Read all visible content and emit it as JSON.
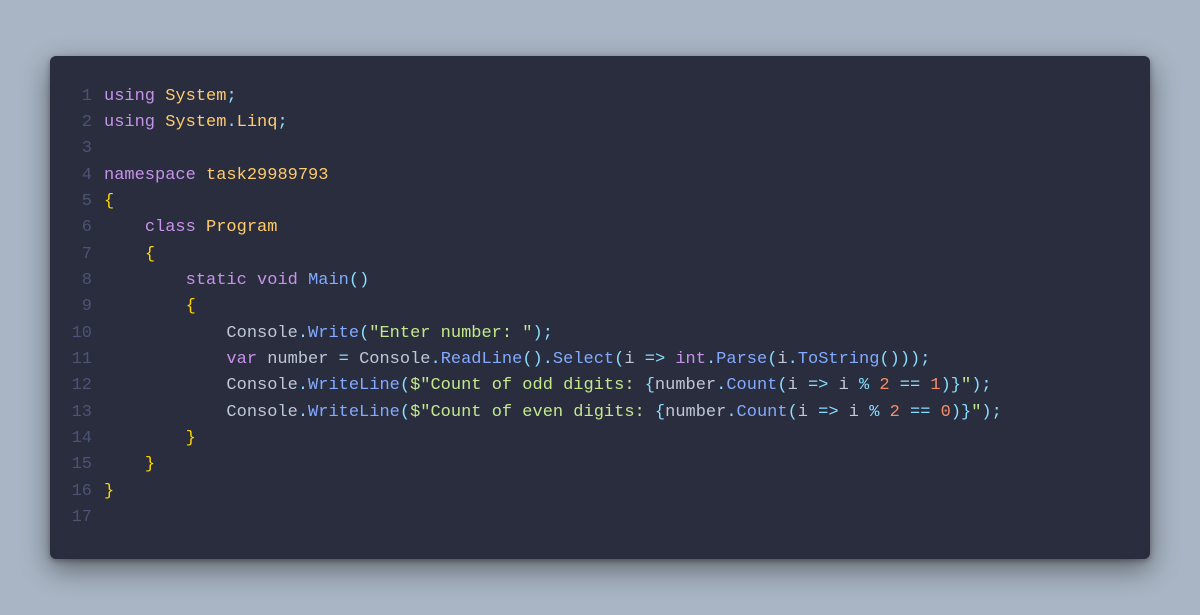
{
  "code": {
    "lines": [
      {
        "n": "1",
        "tokens": [
          {
            "c": "kw",
            "t": "using"
          },
          {
            "c": "",
            "t": " "
          },
          {
            "c": "ns",
            "t": "System"
          },
          {
            "c": "op",
            "t": ";"
          }
        ]
      },
      {
        "n": "2",
        "tokens": [
          {
            "c": "kw",
            "t": "using"
          },
          {
            "c": "",
            "t": " "
          },
          {
            "c": "ns",
            "t": "System"
          },
          {
            "c": "op",
            "t": "."
          },
          {
            "c": "ns",
            "t": "Linq"
          },
          {
            "c": "op",
            "t": ";"
          }
        ]
      },
      {
        "n": "3",
        "tokens": [
          {
            "c": "",
            "t": ""
          }
        ]
      },
      {
        "n": "4",
        "tokens": [
          {
            "c": "kw",
            "t": "namespace"
          },
          {
            "c": "",
            "t": " "
          },
          {
            "c": "ns",
            "t": "task29989793"
          }
        ]
      },
      {
        "n": "5",
        "tokens": [
          {
            "c": "brace",
            "t": "{"
          }
        ]
      },
      {
        "n": "6",
        "tokens": [
          {
            "c": "",
            "t": "    "
          },
          {
            "c": "kw",
            "t": "class"
          },
          {
            "c": "",
            "t": " "
          },
          {
            "c": "ns",
            "t": "Program"
          }
        ]
      },
      {
        "n": "7",
        "tokens": [
          {
            "c": "",
            "t": "    "
          },
          {
            "c": "brace",
            "t": "{"
          }
        ]
      },
      {
        "n": "8",
        "tokens": [
          {
            "c": "",
            "t": "        "
          },
          {
            "c": "kw",
            "t": "static"
          },
          {
            "c": "",
            "t": " "
          },
          {
            "c": "kw",
            "t": "void"
          },
          {
            "c": "",
            "t": " "
          },
          {
            "c": "fn",
            "t": "Main"
          },
          {
            "c": "op",
            "t": "()"
          }
        ]
      },
      {
        "n": "9",
        "tokens": [
          {
            "c": "",
            "t": "        "
          },
          {
            "c": "brace",
            "t": "{"
          }
        ]
      },
      {
        "n": "10",
        "tokens": [
          {
            "c": "",
            "t": "            "
          },
          {
            "c": "id",
            "t": "Console"
          },
          {
            "c": "op",
            "t": "."
          },
          {
            "c": "fn",
            "t": "Write"
          },
          {
            "c": "op",
            "t": "("
          },
          {
            "c": "str",
            "t": "\"Enter number: \""
          },
          {
            "c": "op",
            "t": ")"
          },
          {
            "c": "op",
            "t": ";"
          }
        ]
      },
      {
        "n": "11",
        "tokens": [
          {
            "c": "",
            "t": "            "
          },
          {
            "c": "kw",
            "t": "var"
          },
          {
            "c": "",
            "t": " "
          },
          {
            "c": "id",
            "t": "number"
          },
          {
            "c": "",
            "t": " "
          },
          {
            "c": "op",
            "t": "="
          },
          {
            "c": "",
            "t": " "
          },
          {
            "c": "id",
            "t": "Console"
          },
          {
            "c": "op",
            "t": "."
          },
          {
            "c": "fn",
            "t": "ReadLine"
          },
          {
            "c": "op",
            "t": "()."
          },
          {
            "c": "fn",
            "t": "Select"
          },
          {
            "c": "op",
            "t": "("
          },
          {
            "c": "id",
            "t": "i"
          },
          {
            "c": "",
            "t": " "
          },
          {
            "c": "op",
            "t": "=>"
          },
          {
            "c": "",
            "t": " "
          },
          {
            "c": "kw",
            "t": "int"
          },
          {
            "c": "op",
            "t": "."
          },
          {
            "c": "fn",
            "t": "Parse"
          },
          {
            "c": "op",
            "t": "("
          },
          {
            "c": "id",
            "t": "i"
          },
          {
            "c": "op",
            "t": "."
          },
          {
            "c": "fn",
            "t": "ToString"
          },
          {
            "c": "op",
            "t": "()));"
          }
        ]
      },
      {
        "n": "12",
        "tokens": [
          {
            "c": "",
            "t": "            "
          },
          {
            "c": "id",
            "t": "Console"
          },
          {
            "c": "op",
            "t": "."
          },
          {
            "c": "fn",
            "t": "WriteLine"
          },
          {
            "c": "op",
            "t": "("
          },
          {
            "c": "str",
            "t": "$\"Count of odd digits: "
          },
          {
            "c": "op",
            "t": "{"
          },
          {
            "c": "id",
            "t": "number"
          },
          {
            "c": "op",
            "t": "."
          },
          {
            "c": "fn",
            "t": "Count"
          },
          {
            "c": "op",
            "t": "("
          },
          {
            "c": "id",
            "t": "i"
          },
          {
            "c": "",
            "t": " "
          },
          {
            "c": "op",
            "t": "=>"
          },
          {
            "c": "",
            "t": " "
          },
          {
            "c": "id",
            "t": "i"
          },
          {
            "c": "",
            "t": " "
          },
          {
            "c": "op",
            "t": "%"
          },
          {
            "c": "",
            "t": " "
          },
          {
            "c": "num",
            "t": "2"
          },
          {
            "c": "",
            "t": " "
          },
          {
            "c": "op",
            "t": "=="
          },
          {
            "c": "",
            "t": " "
          },
          {
            "c": "num",
            "t": "1"
          },
          {
            "c": "op",
            "t": ")}"
          },
          {
            "c": "str",
            "t": "\""
          },
          {
            "c": "op",
            "t": ");"
          }
        ]
      },
      {
        "n": "13",
        "tokens": [
          {
            "c": "",
            "t": "            "
          },
          {
            "c": "id",
            "t": "Console"
          },
          {
            "c": "op",
            "t": "."
          },
          {
            "c": "fn",
            "t": "WriteLine"
          },
          {
            "c": "op",
            "t": "("
          },
          {
            "c": "str",
            "t": "$\"Count of even digits: "
          },
          {
            "c": "op",
            "t": "{"
          },
          {
            "c": "id",
            "t": "number"
          },
          {
            "c": "op",
            "t": "."
          },
          {
            "c": "fn",
            "t": "Count"
          },
          {
            "c": "op",
            "t": "("
          },
          {
            "c": "id",
            "t": "i"
          },
          {
            "c": "",
            "t": " "
          },
          {
            "c": "op",
            "t": "=>"
          },
          {
            "c": "",
            "t": " "
          },
          {
            "c": "id",
            "t": "i"
          },
          {
            "c": "",
            "t": " "
          },
          {
            "c": "op",
            "t": "%"
          },
          {
            "c": "",
            "t": " "
          },
          {
            "c": "num",
            "t": "2"
          },
          {
            "c": "",
            "t": " "
          },
          {
            "c": "op",
            "t": "=="
          },
          {
            "c": "",
            "t": " "
          },
          {
            "c": "num",
            "t": "0"
          },
          {
            "c": "op",
            "t": ")}"
          },
          {
            "c": "str",
            "t": "\""
          },
          {
            "c": "op",
            "t": ");"
          }
        ]
      },
      {
        "n": "14",
        "tokens": [
          {
            "c": "",
            "t": "        "
          },
          {
            "c": "brace",
            "t": "}"
          }
        ]
      },
      {
        "n": "15",
        "tokens": [
          {
            "c": "",
            "t": "    "
          },
          {
            "c": "brace",
            "t": "}"
          }
        ]
      },
      {
        "n": "16",
        "tokens": [
          {
            "c": "brace",
            "t": "}"
          }
        ]
      },
      {
        "n": "17",
        "tokens": [
          {
            "c": "",
            "t": ""
          }
        ]
      }
    ]
  }
}
